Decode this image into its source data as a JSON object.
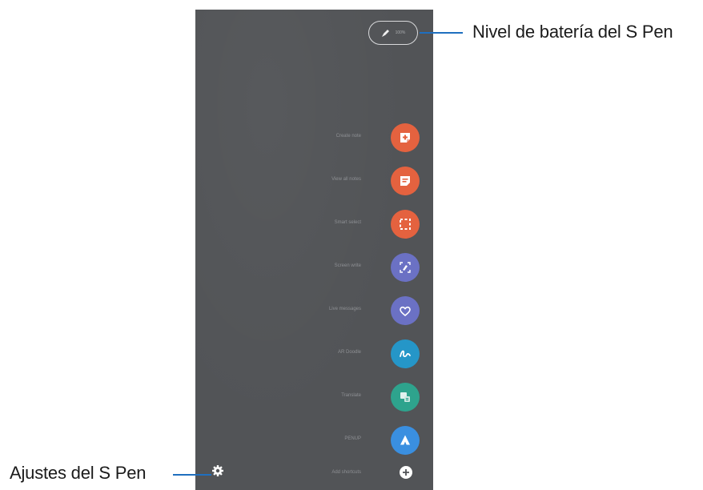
{
  "callouts": {
    "battery": "Nivel de batería del S Pen",
    "settings": "Ajustes del S Pen"
  },
  "battery_pill": {
    "value": "100%"
  },
  "menu": [
    {
      "label": "Create note",
      "icon": "new-note-icon",
      "color": "#e4623f"
    },
    {
      "label": "View all notes",
      "icon": "notes-list-icon",
      "color": "#e4623f"
    },
    {
      "label": "Smart select",
      "icon": "smart-select-icon",
      "color": "#e4623f"
    },
    {
      "label": "Screen write",
      "icon": "screen-write-icon",
      "color": "#6b71c4"
    },
    {
      "label": "Live messages",
      "icon": "live-messages-icon",
      "color": "#6b71c4"
    },
    {
      "label": "AR Doodle",
      "icon": "ar-doodle-icon",
      "color": "#2596c8"
    },
    {
      "label": "Translate",
      "icon": "translate-icon",
      "color": "#2ea38d"
    },
    {
      "label": "PENUP",
      "icon": "penup-icon",
      "color": "#3a8fe0"
    },
    {
      "label": "Add shortcuts",
      "icon": "add-icon",
      "color": "#ffffff"
    }
  ]
}
